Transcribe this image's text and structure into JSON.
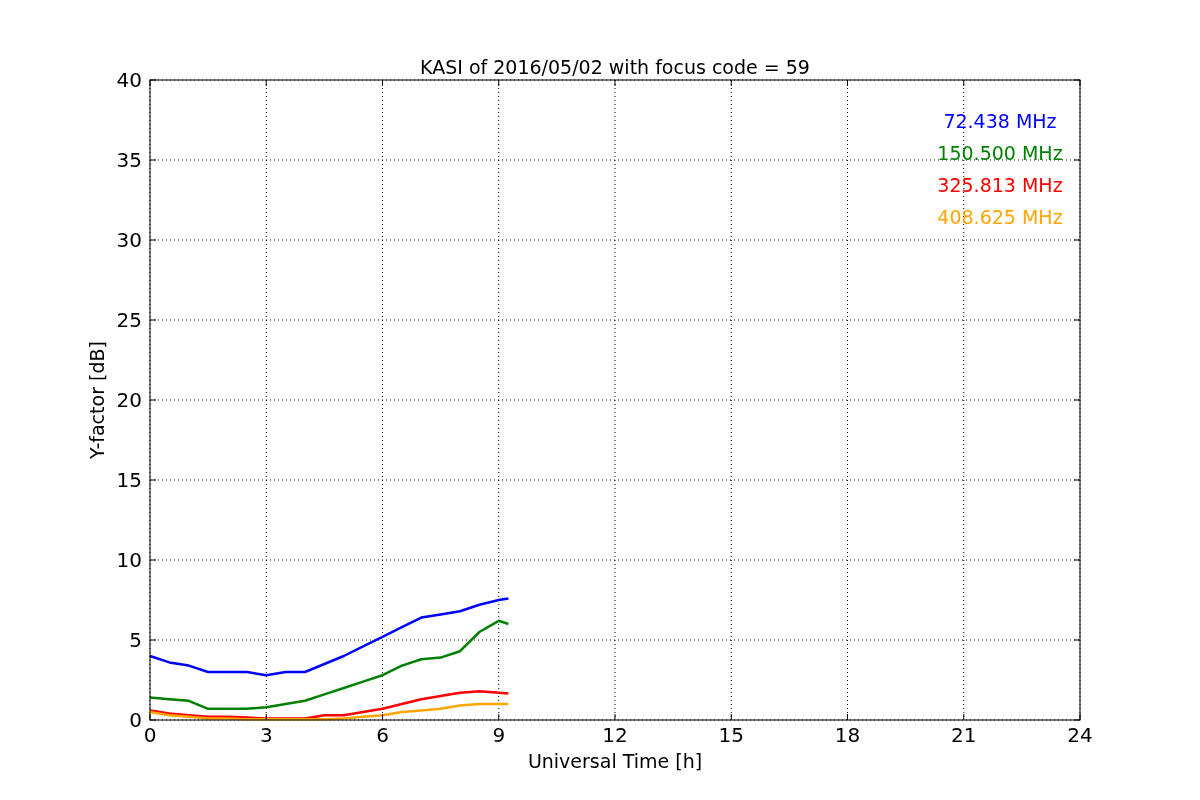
{
  "chart": {
    "chart_data": {
      "type": "line",
      "title": "KASI of 2016/05/02 with focus code = 59",
      "xlabel": "Universal Time [h]",
      "ylabel": "Y-factor [dB]",
      "x": [
        0,
        0.5,
        1,
        1.5,
        2,
        2.5,
        3,
        3.5,
        4,
        4.5,
        5,
        5.5,
        6,
        6.5,
        7,
        7.5,
        8,
        8.5,
        9,
        9.25
      ],
      "series": [
        {
          "name": "72.438 MHz",
          "color": "#0000ff",
          "values": [
            4.0,
            3.6,
            3.4,
            3.0,
            3.0,
            3.0,
            2.8,
            3.0,
            3.0,
            3.5,
            4.0,
            4.6,
            5.2,
            5.8,
            6.4,
            6.6,
            6.8,
            7.2,
            7.5,
            7.6
          ]
        },
        {
          "name": "150.500 MHz",
          "color": "#008000",
          "values": [
            1.4,
            1.3,
            1.2,
            0.7,
            0.7,
            0.7,
            0.8,
            1.0,
            1.2,
            1.6,
            2.0,
            2.4,
            2.8,
            3.4,
            3.8,
            3.9,
            4.3,
            5.5,
            6.2,
            6.0
          ]
        },
        {
          "name": "325.813 MHz",
          "color": "#ff0000",
          "values": [
            0.6,
            0.4,
            0.3,
            0.2,
            0.2,
            0.15,
            0.1,
            0.1,
            0.1,
            0.3,
            0.3,
            0.5,
            0.7,
            1.0,
            1.3,
            1.5,
            1.7,
            1.8,
            1.7,
            1.65
          ]
        },
        {
          "name": "408.625 MHz",
          "color": "#ffa500",
          "values": [
            0.5,
            0.3,
            0.2,
            0.1,
            0.1,
            0.05,
            0.05,
            0.05,
            0.05,
            0.05,
            0.1,
            0.2,
            0.3,
            0.5,
            0.6,
            0.7,
            0.9,
            1.0,
            1.0,
            1.0
          ]
        }
      ],
      "grid": true,
      "xlim": [
        0,
        24
      ],
      "ylim": [
        0,
        40
      ],
      "xticks": [
        0,
        3,
        6,
        9,
        12,
        15,
        18,
        21,
        24
      ],
      "yticks": [
        0,
        5,
        10,
        15,
        20,
        25,
        30,
        35,
        40
      ]
    }
  }
}
